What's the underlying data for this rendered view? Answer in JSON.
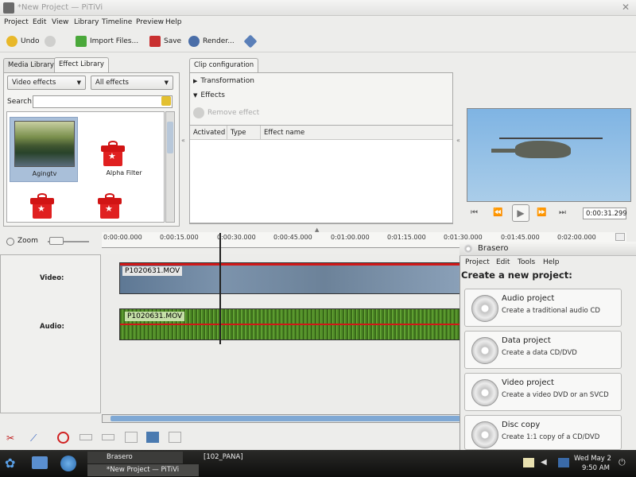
{
  "window": {
    "title": "*New Project — PiTiVi"
  },
  "menu": [
    "Project",
    "Edit",
    "View",
    "Library",
    "Timeline",
    "Preview",
    "Help"
  ],
  "toolbar": {
    "undo": "Undo",
    "import": "Import Files...",
    "save": "Save",
    "render": "Render..."
  },
  "library": {
    "tabs": [
      "Media Library",
      "Effect Library"
    ],
    "category": "Video effects",
    "filter": "All effects",
    "search_label": "Search:",
    "search_value": "",
    "items": [
      "Agingtv",
      "Alpha Filter"
    ]
  },
  "clip_config": {
    "tab": "Clip configuration",
    "sections": [
      "Transformation",
      "Effects"
    ],
    "remove_button": "Remove effect",
    "columns": [
      "Activated",
      "Type",
      "Effect name"
    ]
  },
  "viewer": {
    "timecode": "0:00:31.299"
  },
  "timeline": {
    "zoom_label": "Zoom",
    "ruler": [
      "0:00:00.000",
      "0:00:15.000",
      "0:00:30.000",
      "0:00:45.000",
      "0:01:00.000",
      "0:01:15.000",
      "0:01:30.000",
      "0:01:45.000",
      "0:02:00.000"
    ],
    "tracks": [
      {
        "name": "Video:",
        "clip": "P1020631.MOV"
      },
      {
        "name": "Audio:",
        "clip": "P1020631.MOV"
      }
    ]
  },
  "brasero": {
    "title": "Brasero",
    "menu": [
      "Project",
      "Edit",
      "Tools",
      "Help"
    ],
    "heading": "Create a new project:",
    "items": [
      {
        "title": "Audio project",
        "desc": "Create a traditional audio CD"
      },
      {
        "title": "Data project",
        "desc": "Create a data CD/DVD"
      },
      {
        "title": "Video project",
        "desc": "Create a video DVD or an SVCD"
      },
      {
        "title": "Disc copy",
        "desc": "Create 1:1 copy of a CD/DVD"
      }
    ]
  },
  "taskbar": {
    "tasks": [
      "Brasero",
      "[102_PANA]",
      "*New Project — PiTiVi"
    ],
    "clock_date": "Wed May  2",
    "clock_time": "9:50 AM"
  }
}
